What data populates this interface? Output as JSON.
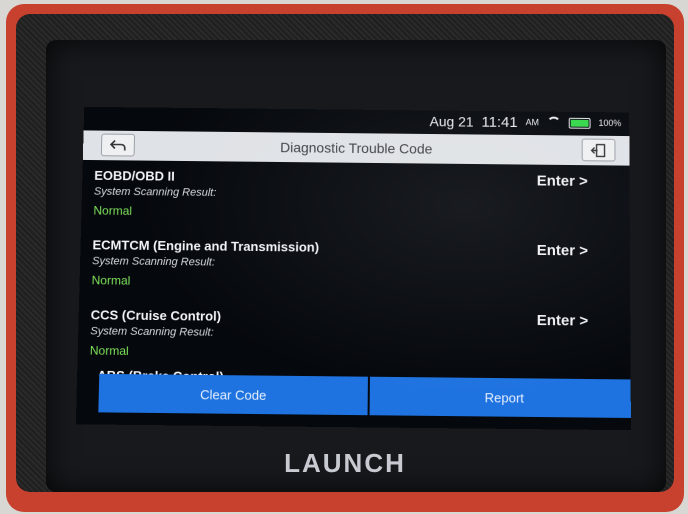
{
  "status_bar": {
    "date": "Aug 21",
    "time": "11:41",
    "ampm": "AM",
    "battery": "100%"
  },
  "header": {
    "title": "Diagnostic Trouble Code",
    "back_icon": "back-arrow-icon",
    "exit_icon": "exit-door-icon"
  },
  "items": [
    {
      "title": "EOBD/OBD II",
      "subtitle": "System Scanning Result:",
      "status": "Normal",
      "action": "Enter >"
    },
    {
      "title": "ECMTCM (Engine and Transmission)",
      "subtitle": "System Scanning Result:",
      "status": "Normal",
      "action": "Enter >"
    },
    {
      "title": "CCS (Cruise Control)",
      "subtitle": "System Scanning Result:",
      "status": "Normal",
      "action": "Enter >"
    }
  ],
  "partial_item": "ABS (Brake Control)",
  "footer": {
    "clear_label": "Clear Code",
    "report_label": "Report"
  },
  "brand": "LAUNCH",
  "colors": {
    "accent": "#1f73e0",
    "normal_status": "#7fe35a",
    "shell": "#c8412f"
  }
}
